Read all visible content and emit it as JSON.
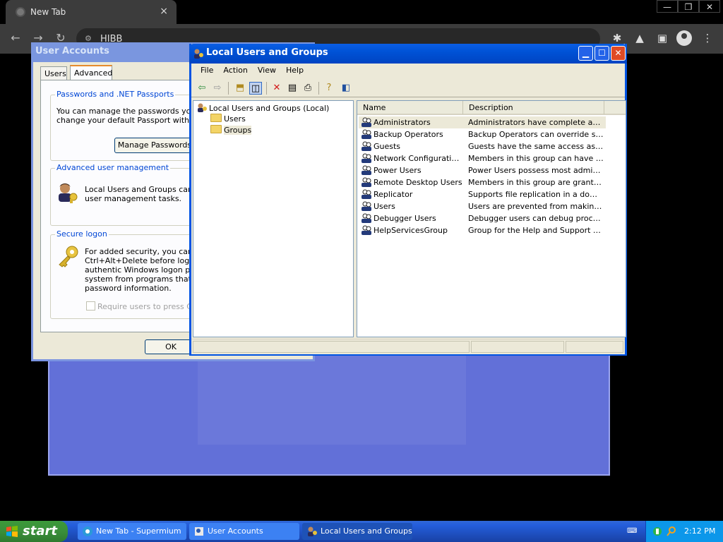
{
  "browser": {
    "tab_title": "New Tab",
    "tab_close": "×",
    "url": "HIBB",
    "window_controls": [
      "—",
      "❐",
      "✕"
    ],
    "nav": {
      "back": "←",
      "forward": "→",
      "reload": "↻"
    },
    "toolbar_icons": [
      "extensions-icon",
      "labs-icon",
      "side-panel-icon",
      "profile-icon",
      "menu-icon"
    ]
  },
  "user_accounts": {
    "title": "User Accounts",
    "tabs": [
      {
        "label": "Users"
      },
      {
        "label": "Advanced"
      }
    ],
    "passports_group": {
      "title": "Passwords and .NET Passports",
      "text_line1": "You can manage the passwords you ha",
      "text_line2": "change your default Passport with the",
      "button": "Manage Passwords"
    },
    "advanced_group": {
      "title": "Advanced user management",
      "text_line1": "Local Users and Groups can be",
      "text_line2": "user management tasks."
    },
    "secure_group": {
      "title": "Secure logon",
      "text_lines": [
        "For added security, you can re",
        "Ctrl+Alt+Delete before logging",
        "authentic Windows logon promp",
        "system from programs that min",
        "password information."
      ],
      "checkbox_label": "Require users to press Ctrl+"
    },
    "ok_button": "OK"
  },
  "lug": {
    "title": "Local Users and Groups",
    "menu": [
      "File",
      "Action",
      "View",
      "Help"
    ],
    "tree": {
      "root": "Local Users and Groups (Local)",
      "children": [
        "Users",
        "Groups"
      ],
      "selected": "Groups"
    },
    "columns": [
      "Name",
      "Description"
    ],
    "rows": [
      {
        "name": "Administrators",
        "description": "Administrators have complete and u..."
      },
      {
        "name": "Backup Operators",
        "description": "Backup Operators can override secu..."
      },
      {
        "name": "Guests",
        "description": "Guests have the same access as me..."
      },
      {
        "name": "Network Configuration ...",
        "description": "Members in this group can have som..."
      },
      {
        "name": "Power Users",
        "description": "Power Users possess most administr..."
      },
      {
        "name": "Remote Desktop Users",
        "description": "Members in this group are granted t..."
      },
      {
        "name": "Replicator",
        "description": "Supports file replication in a domain"
      },
      {
        "name": "Users",
        "description": "Users are prevented from making ac..."
      },
      {
        "name": "Debugger Users",
        "description": "Debugger users can debug processe..."
      },
      {
        "name": "HelpServicesGroup",
        "description": "Group for the Help and Support Center"
      }
    ]
  },
  "taskbar": {
    "start": "start",
    "items": [
      {
        "label": "New Tab - Supermium"
      },
      {
        "label": "User Accounts"
      },
      {
        "label": "Local Users and Groups"
      }
    ],
    "clock": "2:12 PM"
  }
}
